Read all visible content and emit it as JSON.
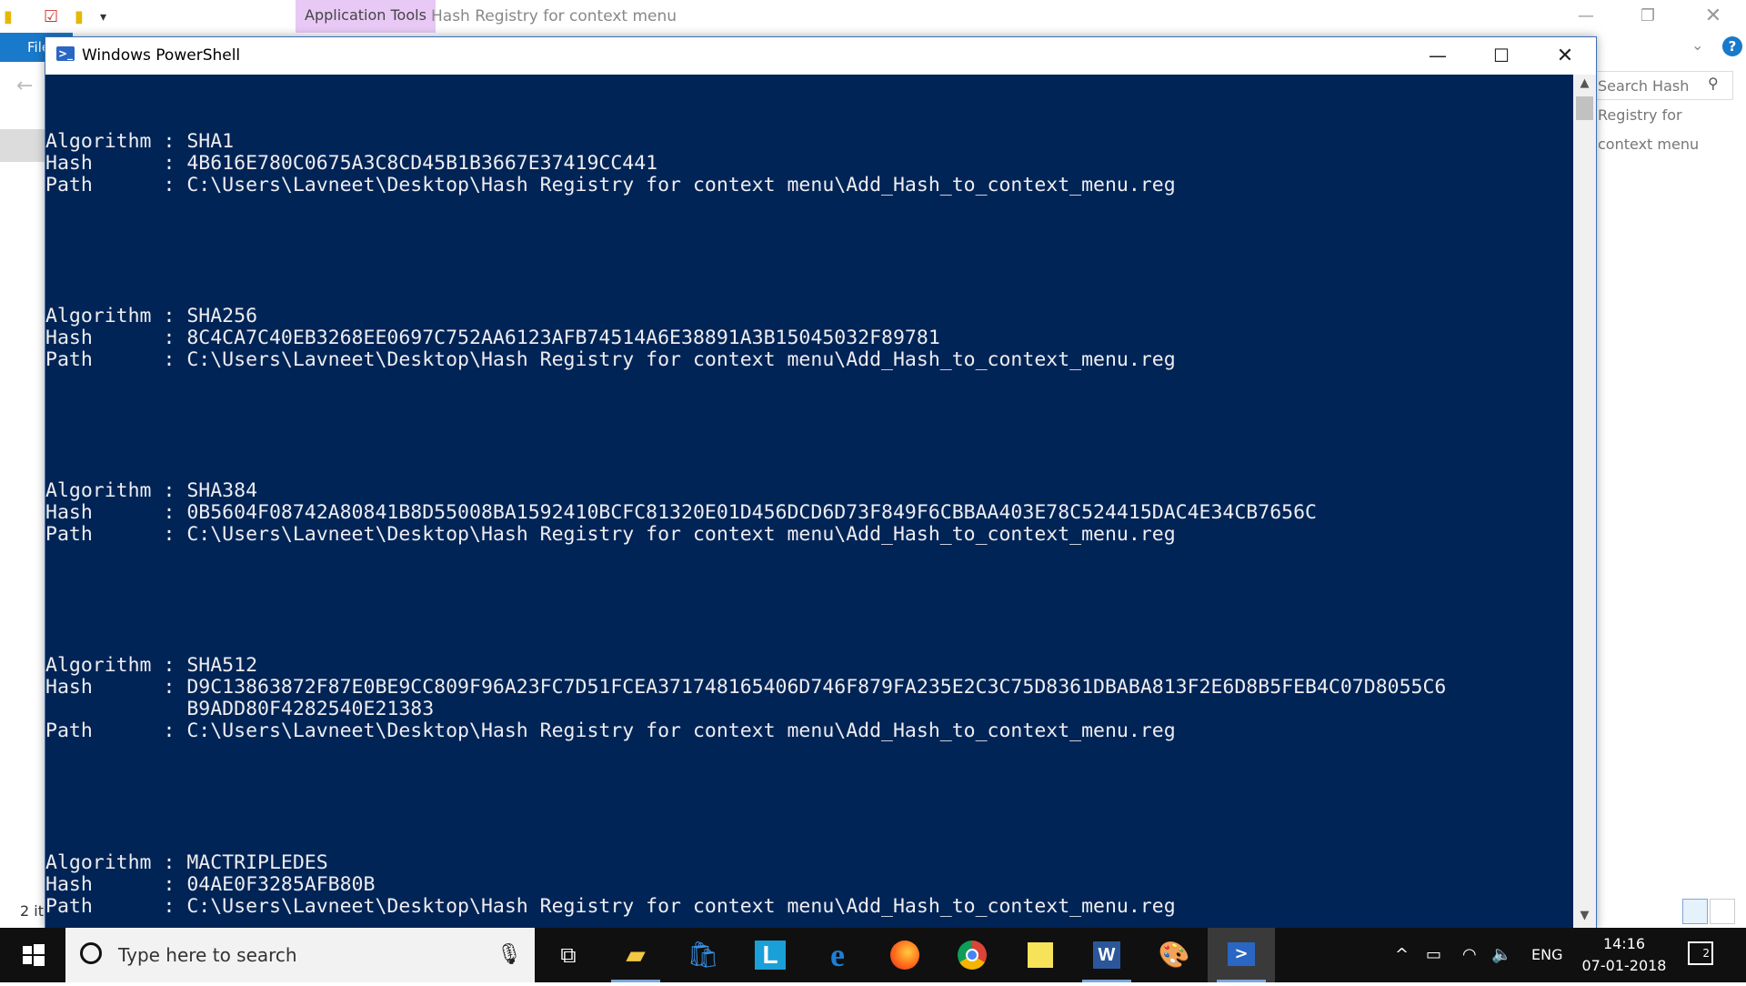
{
  "explorer": {
    "context_tab": "Application Tools",
    "title": "Hash Registry for context menu",
    "file_tab": "File",
    "search_placeholder": "Search Hash Registry for context menu",
    "status_count": "2 it"
  },
  "powershell": {
    "title": "Windows PowerShell",
    "results": [
      {
        "algorithm": "SHA1",
        "hash": [
          "4B616E780C0675A3C8CD45B1B3667E37419CC441"
        ],
        "path": "C:\\Users\\Lavneet\\Desktop\\Hash Registry for context menu\\Add_Hash_to_context_menu.reg"
      },
      {
        "algorithm": "SHA256",
        "hash": [
          "8C4CA7C40EB3268EE0697C752AA6123AFB74514A6E38891A3B15045032F89781"
        ],
        "path": "C:\\Users\\Lavneet\\Desktop\\Hash Registry for context menu\\Add_Hash_to_context_menu.reg"
      },
      {
        "algorithm": "SHA384",
        "hash": [
          "0B5604F08742A80841B8D55008BA1592410BCFC81320E01D456DCD6D73F849F6CBBAA403E78C524415DAC4E34CB7656C"
        ],
        "path": "C:\\Users\\Lavneet\\Desktop\\Hash Registry for context menu\\Add_Hash_to_context_menu.reg"
      },
      {
        "algorithm": "SHA512",
        "hash": [
          "D9C13863872F87E0BE9CC809F96A23FC7D51FCEA371748165406D746F879FA235E2C3C75D8361DBABA813F2E6D8B5FEB4C07D8055C6",
          "B9ADD80F4282540E21383"
        ],
        "path": "C:\\Users\\Lavneet\\Desktop\\Hash Registry for context menu\\Add_Hash_to_context_menu.reg"
      },
      {
        "algorithm": "MACTRIPLEDES",
        "hash": [
          "04AE0F3285AFB80B"
        ],
        "path": "C:\\Users\\Lavneet\\Desktop\\Hash Registry for context menu\\Add_Hash_to_context_menu.reg"
      }
    ]
  },
  "taskbar": {
    "search_placeholder": "Type here to search",
    "language": "ENG",
    "time": "14:16",
    "date": "07-01-2018",
    "notification_count": "2",
    "apps": [
      "task-view-icon",
      "file-explorer-icon",
      "store-icon",
      "l-app-icon",
      "edge-icon",
      "firefox-icon",
      "chrome-icon",
      "sticky-notes-icon",
      "word-icon",
      "paint-icon",
      "powershell-icon"
    ]
  },
  "colors": {
    "console_bg": "#012456",
    "console_fg": "#eeedf0",
    "accent": "#1979ca",
    "context_tab": "#e8c9f5",
    "taskbar": "#101010"
  }
}
